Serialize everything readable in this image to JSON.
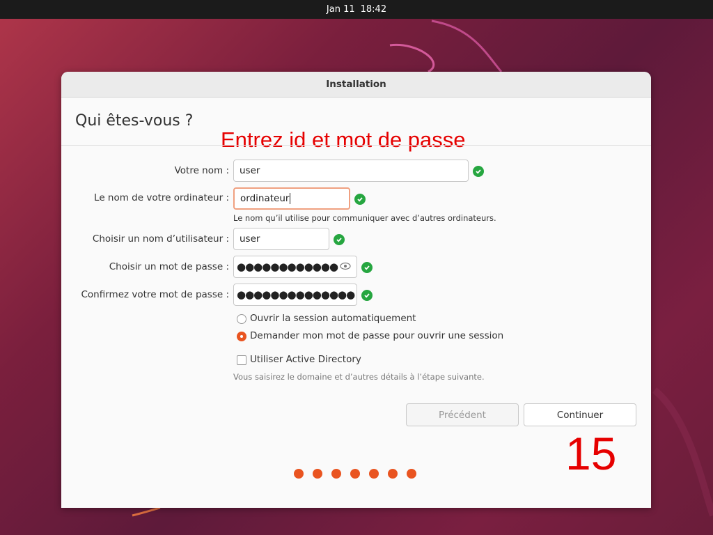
{
  "topbar": {
    "date": "Jan 11",
    "time": "18:42"
  },
  "window": {
    "title": "Installation"
  },
  "page": {
    "title": "Qui êtes-vous ?",
    "overlay_instruction": "Entrez id et mot de passe",
    "counter": "15"
  },
  "form": {
    "name_label": "Votre nom :",
    "name_value": "user",
    "computer_label": "Le nom de votre ordinateur :",
    "computer_value": "ordinateur",
    "computer_hint": "Le nom qu’il utilise pour communiquer avec d’autres ordinateurs.",
    "username_label": "Choisir un nom d’utilisateur :",
    "username_value": "user",
    "password_label": "Choisir un mot de passe :",
    "password_value": "●●●●●●●●●●●●",
    "confirm_label": "Confirmez votre mot de passe :",
    "confirm_value": "●●●●●●●●●●●●●●"
  },
  "login_options": [
    {
      "label": "Ouvrir la session automatiquement",
      "selected": false
    },
    {
      "label": "Demander mon mot de passe pour ouvrir une session",
      "selected": true
    }
  ],
  "active_directory": {
    "label": "Utiliser Active Directory",
    "checked": false,
    "hint": "Vous saisirez le domaine et d’autres détails à l’étape suivante."
  },
  "buttons": {
    "previous": "Précédent",
    "continue": "Continuer"
  },
  "progress": {
    "steps": 7
  },
  "colors": {
    "accent": "#e95420",
    "valid": "#26a640",
    "overlay": "#e60000"
  },
  "icons": [
    "check-icon",
    "eye-icon"
  ]
}
